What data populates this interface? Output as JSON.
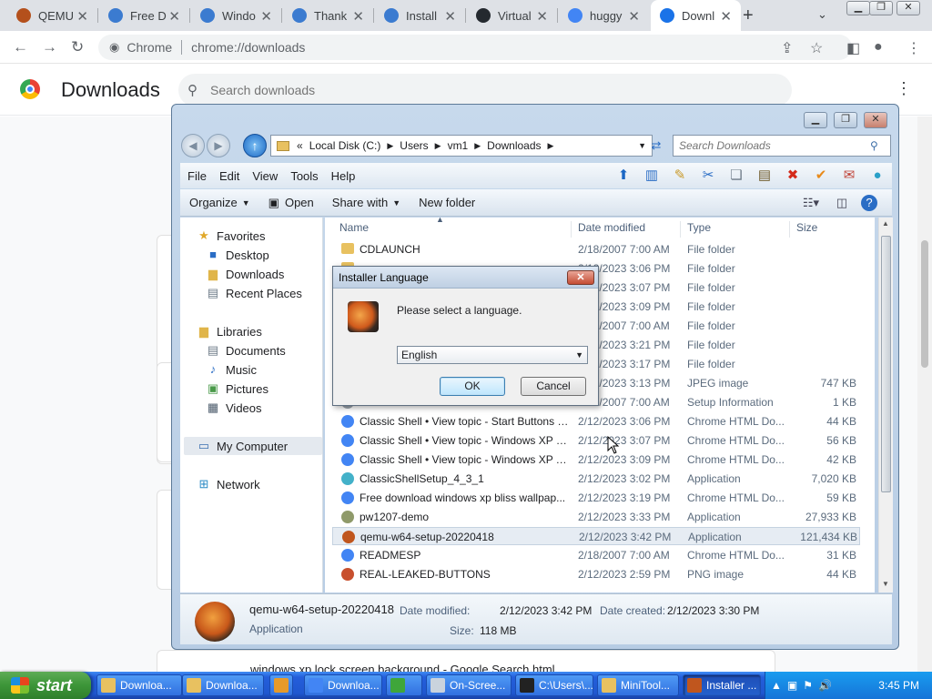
{
  "browser": {
    "tabs": [
      {
        "title": "QEMU",
        "icon": "qemu-icon",
        "color": "#b4501c"
      },
      {
        "title": "Free D",
        "icon": "bliss-icon",
        "color": "#3b7bd0"
      },
      {
        "title": "Windo",
        "icon": "bliss-icon",
        "color": "#3b7bd0"
      },
      {
        "title": "Thank",
        "icon": "bliss-icon",
        "color": "#3b7bd0"
      },
      {
        "title": "Install",
        "icon": "bliss-icon",
        "color": "#3b7bd0"
      },
      {
        "title": "Virtual",
        "icon": "github-icon",
        "color": "#24292f"
      },
      {
        "title": "huggy",
        "icon": "google-icon",
        "color": "#4285f4"
      },
      {
        "title": "Downl",
        "icon": "download-icon",
        "color": "#1a73e8"
      }
    ],
    "active_tab_index": 7,
    "omnibox": {
      "site_label": "Chrome",
      "url": "chrome://downloads"
    }
  },
  "downloads_page": {
    "title": "Downloads",
    "search_placeholder": "Search downloads",
    "bottom_item": "windows xp lock screen background - Google Search.html"
  },
  "explorer": {
    "breadcrumb": [
      "Local Disk (C:)",
      "Users",
      "vm1",
      "Downloads"
    ],
    "breadcrumb_prefix": "«",
    "search_placeholder": "Search Downloads",
    "menu": [
      "File",
      "Edit",
      "View",
      "Tools",
      "Help"
    ],
    "commands": [
      {
        "label": "Organize",
        "dropdown": true
      },
      {
        "label": "Open",
        "dropdown": false
      },
      {
        "label": "Share with",
        "dropdown": true
      },
      {
        "label": "New folder",
        "dropdown": false
      }
    ],
    "nav": {
      "favorites_label": "Favorites",
      "favorites": [
        "Desktop",
        "Downloads",
        "Recent Places"
      ],
      "libraries_label": "Libraries",
      "libraries": [
        "Documents",
        "Music",
        "Pictures",
        "Videos"
      ],
      "computer_label": "My Computer",
      "network_label": "Network"
    },
    "columns": {
      "name": "Name",
      "date": "Date modified",
      "type": "Type",
      "size": "Size"
    },
    "files": [
      {
        "name": "CDLAUNCH",
        "date": "2/18/2007 7:00 AM",
        "type": "File folder",
        "size": "",
        "icon": "folder-icon",
        "color": "#e8c160"
      },
      {
        "name": "",
        "date": "2/12/2023 3:06 PM",
        "type": "File folder",
        "size": "",
        "icon": "folder-icon",
        "color": "#e8c160"
      },
      {
        "name": "",
        "date": "2/12/2023 3:07 PM",
        "type": "File folder",
        "size": "",
        "icon": "folder-icon",
        "color": "#e8c160"
      },
      {
        "name": "",
        "date": "2/12/2023 3:09 PM",
        "type": "File folder",
        "size": "",
        "icon": "folder-icon",
        "color": "#e8c160"
      },
      {
        "name": "",
        "date": "2/18/2007 7:00 AM",
        "type": "File folder",
        "size": "",
        "icon": "folder-icon",
        "color": "#e8c160"
      },
      {
        "name": "",
        "date": "2/12/2023 3:21 PM",
        "type": "File folder",
        "size": "",
        "icon": "folder-icon",
        "color": "#e8c160"
      },
      {
        "name": "",
        "date": "2/12/2023 3:17 PM",
        "type": "File folder",
        "size": "",
        "icon": "folder-icon",
        "color": "#e8c160"
      },
      {
        "name": "",
        "date": "2/12/2023 3:13 PM",
        "type": "JPEG image",
        "size": "747 KB",
        "icon": "image-icon",
        "color": "#5a8fc9"
      },
      {
        "name": "AUTORUN",
        "date": "2/18/2007 7:00 AM",
        "type": "Setup Information",
        "size": "1 KB",
        "icon": "setup-info-icon",
        "color": "#9aa4ad"
      },
      {
        "name": "Classic Shell • View topic - Start Buttons (...",
        "date": "2/12/2023 3:06 PM",
        "type": "Chrome HTML Do...",
        "size": "44 KB",
        "icon": "chrome-icon",
        "color": "#4285f4"
      },
      {
        "name": "Classic Shell • View topic - Windows XP S...",
        "date": "2/12/2023 3:07 PM",
        "type": "Chrome HTML Do...",
        "size": "56 KB",
        "icon": "chrome-icon",
        "color": "#4285f4"
      },
      {
        "name": "Classic Shell • View topic - Windows XP T...",
        "date": "2/12/2023 3:09 PM",
        "type": "Chrome HTML Do...",
        "size": "42 KB",
        "icon": "chrome-icon",
        "color": "#4285f4"
      },
      {
        "name": "ClassicShellSetup_4_3_1",
        "date": "2/12/2023 3:02 PM",
        "type": "Application",
        "size": "7,020 KB",
        "icon": "shell-icon",
        "color": "#43b1c9"
      },
      {
        "name": "Free download windows xp bliss wallpap...",
        "date": "2/12/2023 3:19 PM",
        "type": "Chrome HTML Do...",
        "size": "59 KB",
        "icon": "chrome-icon",
        "color": "#4285f4"
      },
      {
        "name": "pw1207-demo",
        "date": "2/12/2023 3:33 PM",
        "type": "Application",
        "size": "27,933 KB",
        "icon": "installer-icon",
        "color": "#8f9a6a"
      },
      {
        "name": "qemu-w64-setup-20220418",
        "date": "2/12/2023 3:42 PM",
        "type": "Application",
        "size": "121,434 KB",
        "icon": "qemu-icon",
        "color": "#c0561e"
      },
      {
        "name": "READMESP",
        "date": "2/18/2007 7:00 AM",
        "type": "Chrome HTML Do...",
        "size": "31 KB",
        "icon": "chrome-icon",
        "color": "#4285f4"
      },
      {
        "name": "REAL-LEAKED-BUTTONS",
        "date": "2/12/2023 2:59 PM",
        "type": "PNG image",
        "size": "44 KB",
        "icon": "image-icon",
        "color": "#c8502e"
      }
    ],
    "selected_index": 15,
    "details": {
      "name": "qemu-w64-setup-20220418",
      "kind": "Application",
      "modified_label": "Date modified:",
      "modified": "2/12/2023 3:42 PM",
      "created_label": "Date created:",
      "created": "2/12/2023 3:30 PM",
      "size_label": "Size:",
      "size": "118 MB"
    }
  },
  "dialog": {
    "title": "Installer Language",
    "message": "Please select a language.",
    "selected_language": "English",
    "ok": "OK",
    "cancel": "Cancel"
  },
  "taskbar": {
    "start": "start",
    "buttons": [
      {
        "label": "Downloa...",
        "icon": "folder-icon",
        "color": "#e8c160"
      },
      {
        "label": "Downloa...",
        "icon": "folder-icon",
        "color": "#e8c160"
      },
      {
        "label": "",
        "icon": "media-icon",
        "color": "#e69a2a"
      },
      {
        "label": "Downloa...",
        "icon": "chrome-icon",
        "color": "#4285f4"
      },
      {
        "label": "",
        "icon": "cmd-icon",
        "color": "#3fa63a"
      },
      {
        "label": "On-Scree...",
        "icon": "keyboard-icon",
        "color": "#c9d3dd"
      },
      {
        "label": "C:\\Users\\...",
        "icon": "7zip-icon",
        "color": "#222222"
      },
      {
        "label": "MiniTool...",
        "icon": "minitool-icon",
        "color": "#e8c160"
      },
      {
        "label": "Installer ...",
        "icon": "qemu-icon",
        "color": "#c0561e"
      }
    ],
    "active_index": 8,
    "clock": "3:45 PM"
  }
}
